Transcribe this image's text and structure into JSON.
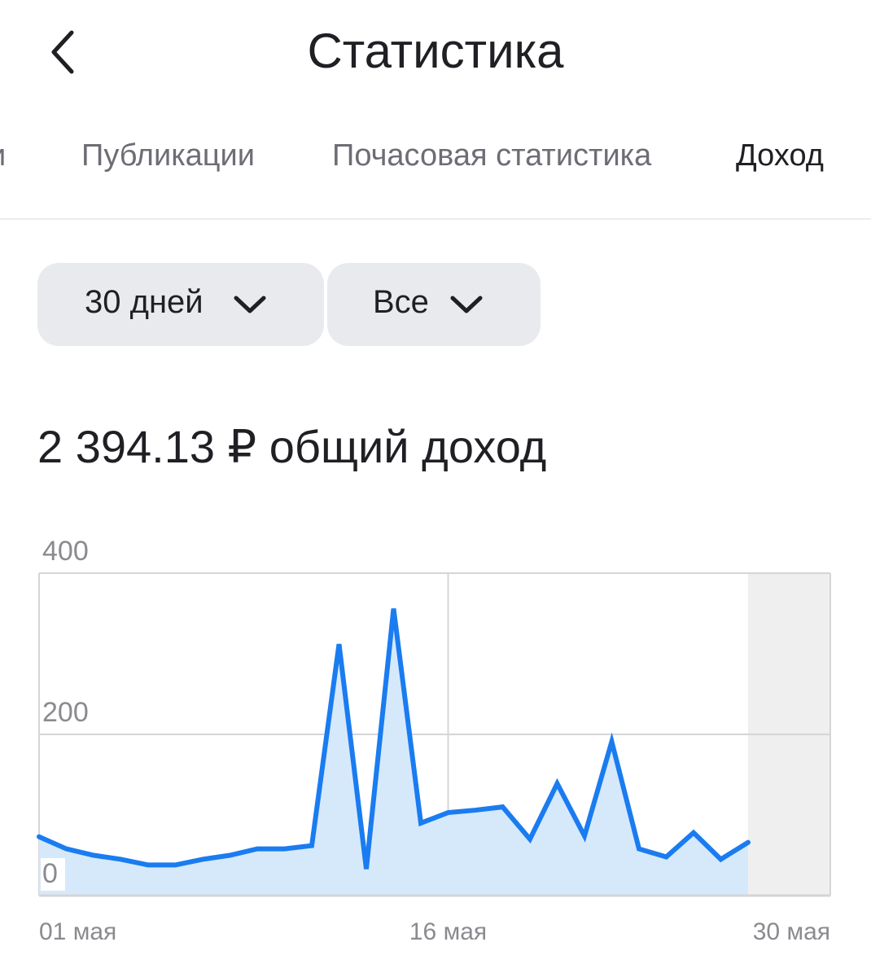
{
  "header": {
    "title": "Статистика",
    "back_icon": "chevron-left-icon"
  },
  "tabs": [
    {
      "label": "и",
      "active": false
    },
    {
      "label": "Публикации",
      "active": false
    },
    {
      "label": "Почасовая статистика",
      "active": false
    },
    {
      "label": "Доход",
      "active": true
    }
  ],
  "filters": {
    "period": {
      "label": "30 дней",
      "icon": "chevron-down-icon"
    },
    "type": {
      "label": "Все",
      "icon": "chevron-down-icon"
    }
  },
  "summary": {
    "total_text": "2 394.13 ₽ общий доход"
  },
  "colors": {
    "accent": "#1a7cf0",
    "area_fill": "#d6e9fb",
    "grid": "#d5d5d8",
    "future_zone": "#efeff0",
    "axis_text": "#8a8a90"
  },
  "chart_data": {
    "type": "area",
    "x": [
      "01 мая",
      "02 мая",
      "03 мая",
      "04 мая",
      "05 мая",
      "06 мая",
      "07 мая",
      "08 мая",
      "09 мая",
      "10 мая",
      "11 мая",
      "12 мая",
      "13 мая",
      "14 мая",
      "15 мая",
      "16 мая",
      "17 мая",
      "18 мая",
      "19 мая",
      "20 мая",
      "21 мая",
      "22 мая",
      "23 мая",
      "24 мая",
      "25 мая",
      "26 мая",
      "27 мая",
      "28 мая"
    ],
    "values": [
      73,
      58,
      50,
      45,
      38,
      38,
      45,
      50,
      58,
      58,
      62,
      312,
      33,
      356,
      90,
      103,
      106,
      110,
      70,
      139,
      74,
      191,
      58,
      48,
      78,
      45,
      66
    ],
    "ylim": [
      0,
      400
    ],
    "yticks": [
      "0",
      "200",
      "400"
    ],
    "xtick_labels": [
      "01 мая",
      "16 мая",
      "30 мая"
    ],
    "grid": true,
    "future_zone_start_index": 26
  }
}
